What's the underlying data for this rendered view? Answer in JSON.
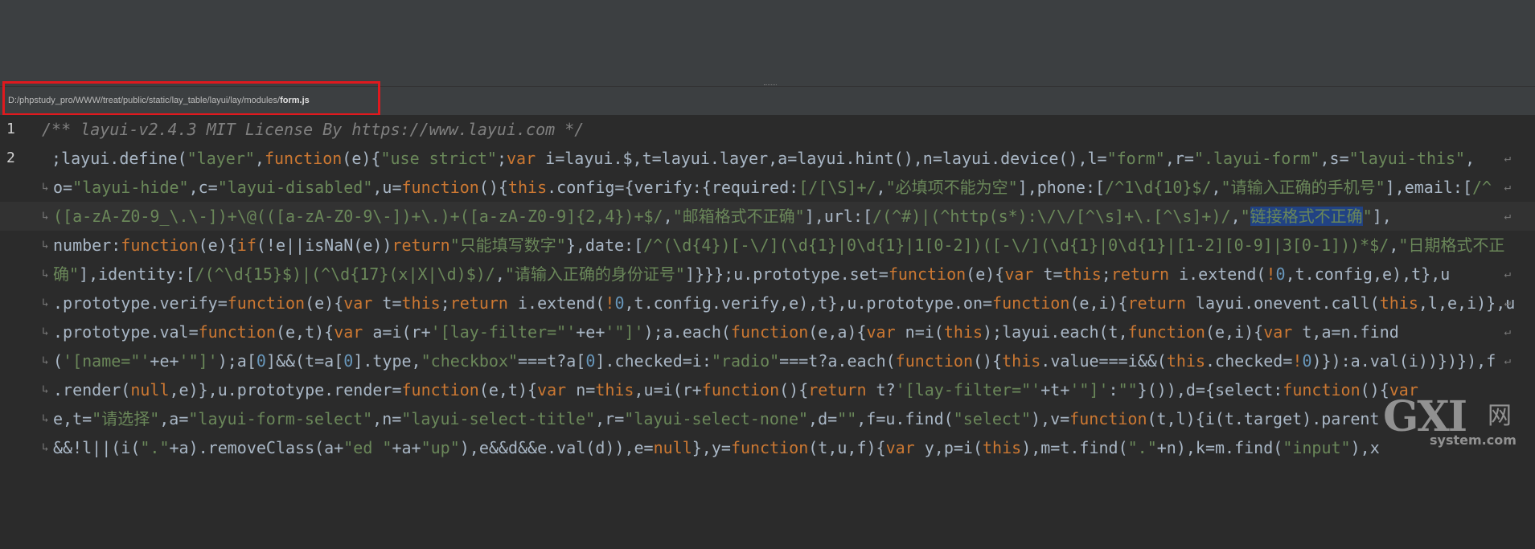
{
  "file_path": {
    "dir": "D:/phpstudy_pro/WWW/treat/public/static/lay_table/layui/lay/modules/",
    "file": "form.js"
  },
  "gutter": [
    "1",
    "2"
  ],
  "watermark": {
    "mark": "GXI",
    "net": "网",
    "domain": "system.com"
  },
  "colors": {
    "keyword": "#cc7832",
    "string": "#6a8759",
    "comment": "#808080",
    "number": "#6897bb",
    "property": "#9876aa",
    "highlight_box": "#e0191e"
  }
}
